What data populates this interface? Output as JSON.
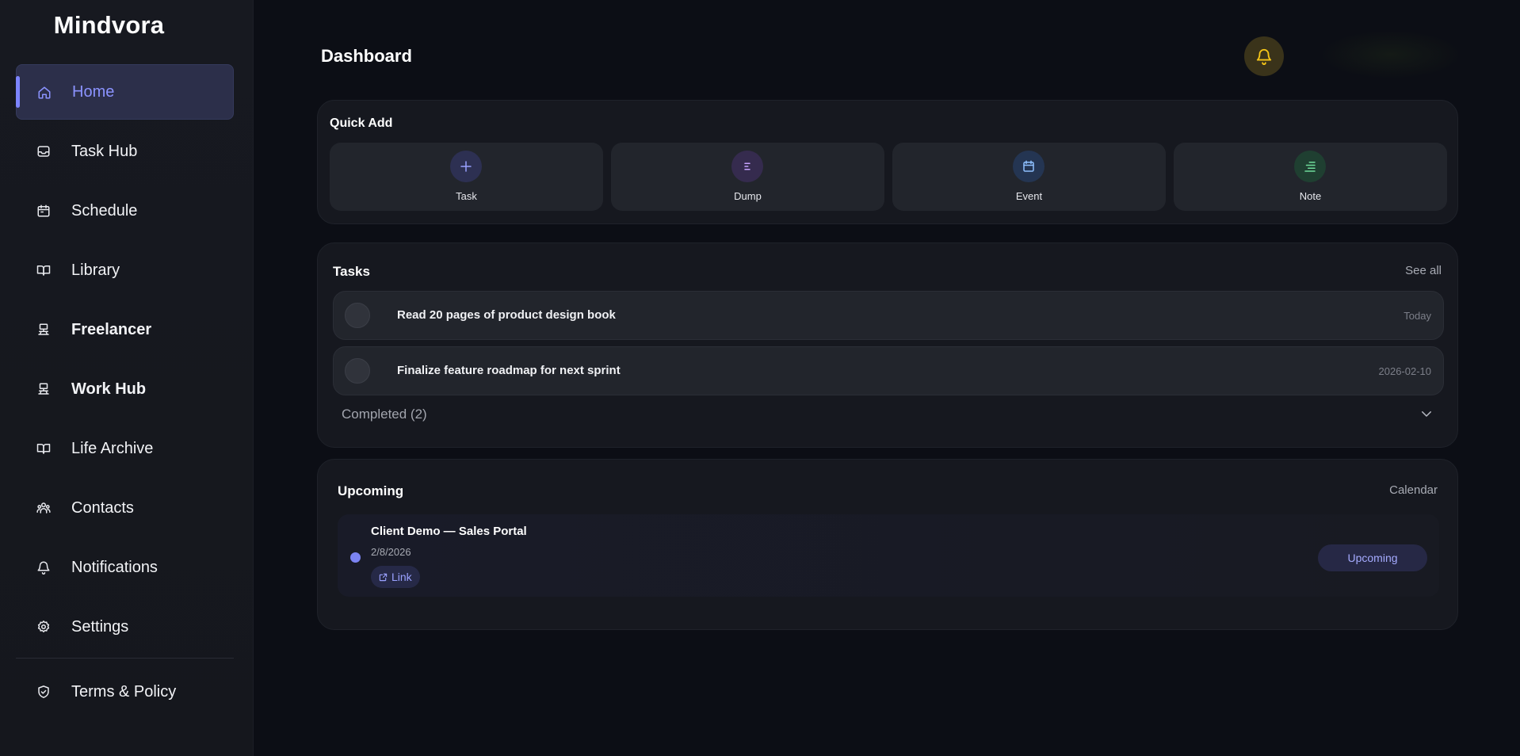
{
  "app": {
    "brand": "Mindvora"
  },
  "sidebar": {
    "items": [
      {
        "label": "Home",
        "icon": "home-icon"
      },
      {
        "label": "Task Hub",
        "icon": "inbox-icon"
      },
      {
        "label": "Schedule",
        "icon": "calendar-icon"
      },
      {
        "label": "Library",
        "icon": "book-icon"
      },
      {
        "label": "Freelancer",
        "icon": "laptop-icon"
      },
      {
        "label": "Work Hub",
        "icon": "laptop-icon"
      },
      {
        "label": "Life Archive",
        "icon": "book-icon"
      },
      {
        "label": "Contacts",
        "icon": "users-icon"
      },
      {
        "label": "Notifications",
        "icon": "bell-icon"
      },
      {
        "label": "Settings",
        "icon": "gear-icon"
      }
    ],
    "bottom": {
      "label": "Terms & Policy",
      "icon": "shield-icon"
    },
    "active_index": 0
  },
  "header": {
    "title": "Dashboard"
  },
  "quick_add": {
    "title": "Quick Add",
    "buttons": [
      {
        "label": "Task",
        "icon": "plus-icon",
        "color": "#9aa1ff"
      },
      {
        "label": "Dump",
        "icon": "lines-icon",
        "color": "#c6a3ff"
      },
      {
        "label": "Event",
        "icon": "calendar-icon",
        "color": "#8ec0ff"
      },
      {
        "label": "Note",
        "icon": "note-icon",
        "color": "#6fdc9a"
      }
    ]
  },
  "tasks": {
    "title": "Tasks",
    "see_all": "See all",
    "items": [
      {
        "text": "Read 20 pages of product design book",
        "date": "Today"
      },
      {
        "text": "Finalize feature roadmap for next sprint",
        "date": "2026-02-10"
      }
    ],
    "completed_label": "Completed (2)"
  },
  "upcoming": {
    "title": "Upcoming",
    "calendar_link": "Calendar",
    "events": [
      {
        "title": "Client Demo — Sales Portal",
        "date": "2/8/2026",
        "link_label": "Link",
        "status": "Upcoming"
      }
    ]
  },
  "colors": {
    "accent": "#7c84ff",
    "bell": "#f5c518",
    "background": "#0c0e15"
  }
}
